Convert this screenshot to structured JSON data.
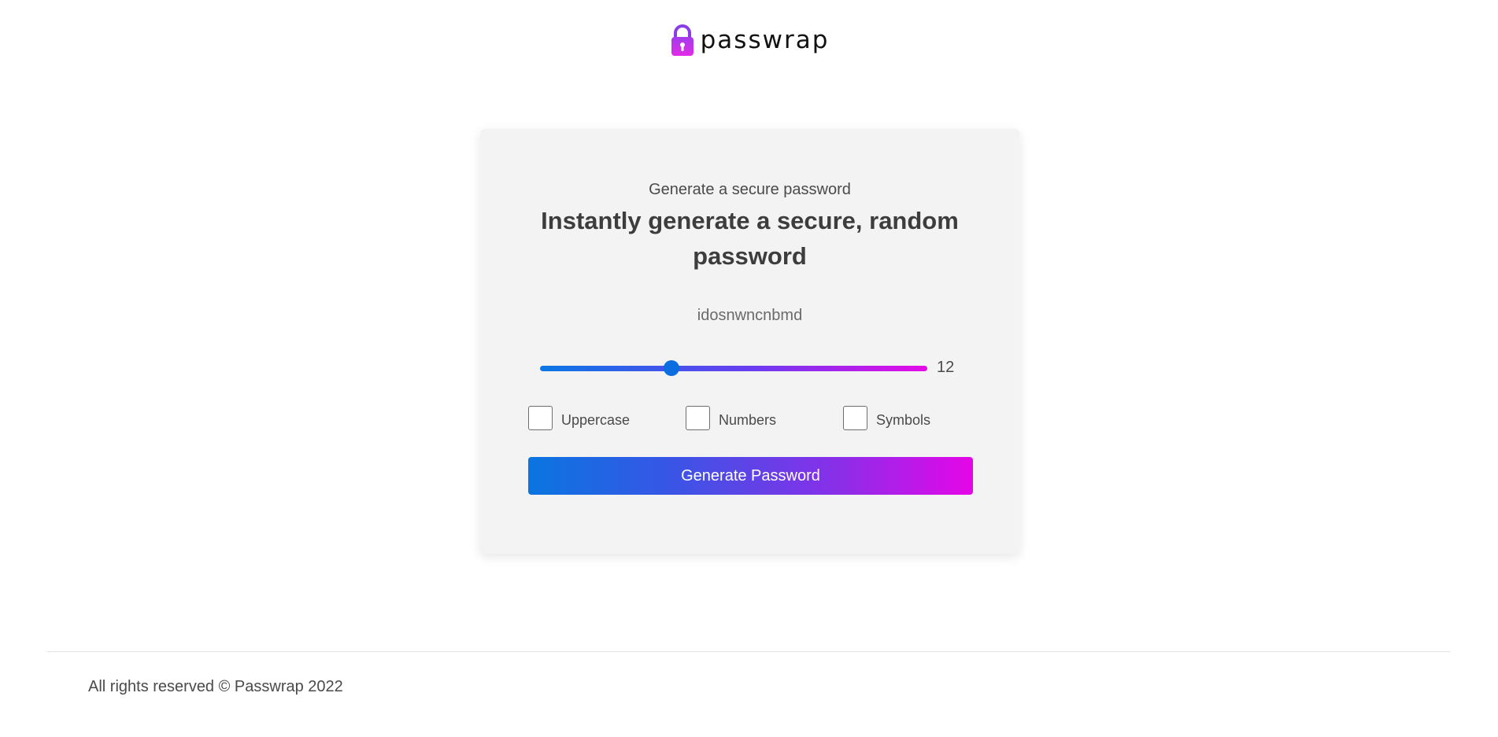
{
  "brand": {
    "logo_icon": "padlock-icon",
    "name": "passwrap",
    "icon_colors": [
      "#a23bec",
      "#e22ce6"
    ]
  },
  "generator": {
    "eyebrow": "Generate a secure password",
    "title": "Instantly generate a secure, random password",
    "password": "idosnwncnbmd",
    "length": {
      "value": "12",
      "fraction": 0.34
    },
    "options": [
      {
        "label": "Uppercase",
        "checked": false
      },
      {
        "label": "Numbers",
        "checked": false
      },
      {
        "label": "Symbols",
        "checked": false
      }
    ],
    "button_label": "Generate Password",
    "gradient_colors": [
      "#0a75e0",
      "#e606e8"
    ]
  },
  "footer": {
    "text": "All rights reserved © Passwrap 2022"
  }
}
